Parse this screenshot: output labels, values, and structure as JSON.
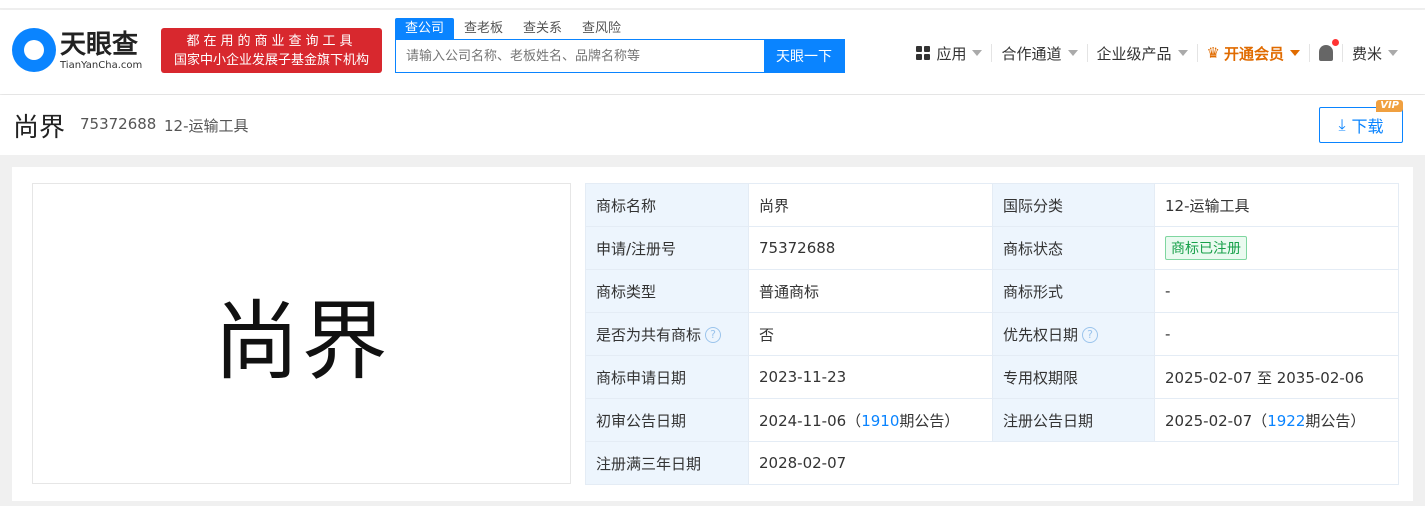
{
  "header": {
    "logo_cn": "天眼查",
    "logo_en": "TianYanCha.com",
    "slogan_line1": "都在用的商业查询工具",
    "slogan_line2": "国家中小企业发展子基金旗下机构",
    "search_tabs": [
      "查公司",
      "查老板",
      "查关系",
      "查风险"
    ],
    "search_placeholder": "请输入公司名称、老板姓名、品牌名称等",
    "search_button": "天眼一下",
    "nav": {
      "apps": "应用",
      "channel": "合作通道",
      "enterprise": "企业级产品",
      "vip": "开通会员",
      "user": "费米"
    }
  },
  "title": {
    "name": "尚界",
    "reg_no": "75372688",
    "class": "12-运输工具",
    "download": "下载",
    "vip_badge": "VIP"
  },
  "trademark_image_text": "尚界",
  "details": {
    "rows": [
      [
        {
          "k": "商标名称"
        },
        {
          "v": "尚界"
        },
        {
          "k": "国际分类"
        },
        {
          "v": "12-运输工具"
        }
      ],
      [
        {
          "k": "申请/注册号"
        },
        {
          "v": "75372688"
        },
        {
          "k": "商标状态"
        },
        {
          "tag": "商标已注册"
        }
      ],
      [
        {
          "k": "商标类型"
        },
        {
          "v": "普通商标"
        },
        {
          "k": "商标形式"
        },
        {
          "v": "-"
        }
      ],
      [
        {
          "k": "是否为共有商标",
          "help": "?"
        },
        {
          "v": "否"
        },
        {
          "k": "优先权日期",
          "help": "?"
        },
        {
          "v": "-"
        }
      ],
      [
        {
          "k": "商标申请日期"
        },
        {
          "v": "2023-11-23"
        },
        {
          "k": "专用权期限"
        },
        {
          "v": "2025-02-07 至 2035-02-06"
        }
      ],
      [
        {
          "k": "初审公告日期"
        },
        {
          "v": "2024-11-06（",
          "link": "1910",
          "after": "期公告）"
        },
        {
          "k": "注册公告日期"
        },
        {
          "v": "2025-02-07（",
          "link": "1922",
          "after": "期公告）"
        }
      ],
      [
        {
          "k": "注册满三年日期"
        },
        {
          "v": "2028-02-07"
        }
      ]
    ]
  }
}
